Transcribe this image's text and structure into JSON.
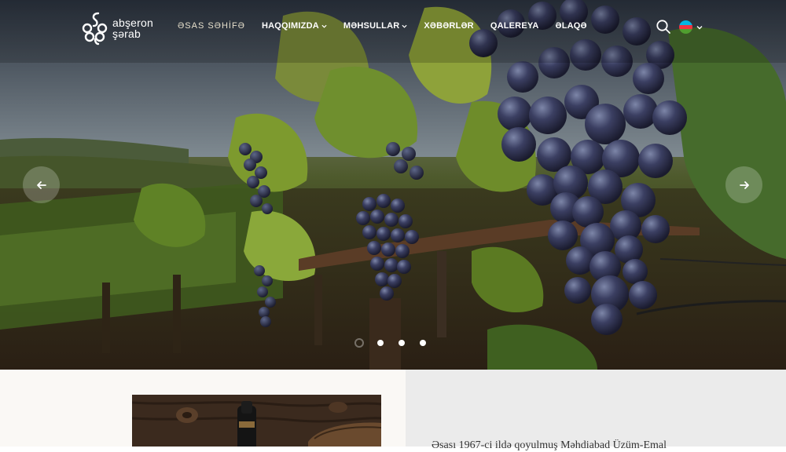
{
  "brand": {
    "line1": "abşeron",
    "line2": "şərab"
  },
  "nav": {
    "items": [
      {
        "label": "ƏSAS SƏHİFƏ",
        "dropdown": false,
        "active": true
      },
      {
        "label": "HAQQIMIZDA",
        "dropdown": true,
        "active": false
      },
      {
        "label": "MƏHSULLAR",
        "dropdown": true,
        "active": false
      },
      {
        "label": "XƏBƏRLƏR",
        "dropdown": false,
        "active": false
      },
      {
        "label": "QALEREYA",
        "dropdown": false,
        "active": false
      },
      {
        "label": "ƏLAQƏ",
        "dropdown": false,
        "active": false
      }
    ],
    "search_icon": "search-icon",
    "language": {
      "flag": "azerbaijan-flag",
      "flag_colors": [
        "#00b5e2",
        "#ef3340",
        "#509e2f"
      ]
    }
  },
  "slider": {
    "prev_icon": "arrow-left-icon",
    "next_icon": "arrow-right-icon",
    "slide_count": 4,
    "active_index": 0
  },
  "about": {
    "text": "Əsası 1967-ci ildə qoyulmuş Məhdiabad Üzüm-Emal"
  },
  "colors": {
    "nav_text": "#ffffff",
    "lower_left_bg": "#faf8f5",
    "lower_right_bg": "#ebebeb"
  }
}
